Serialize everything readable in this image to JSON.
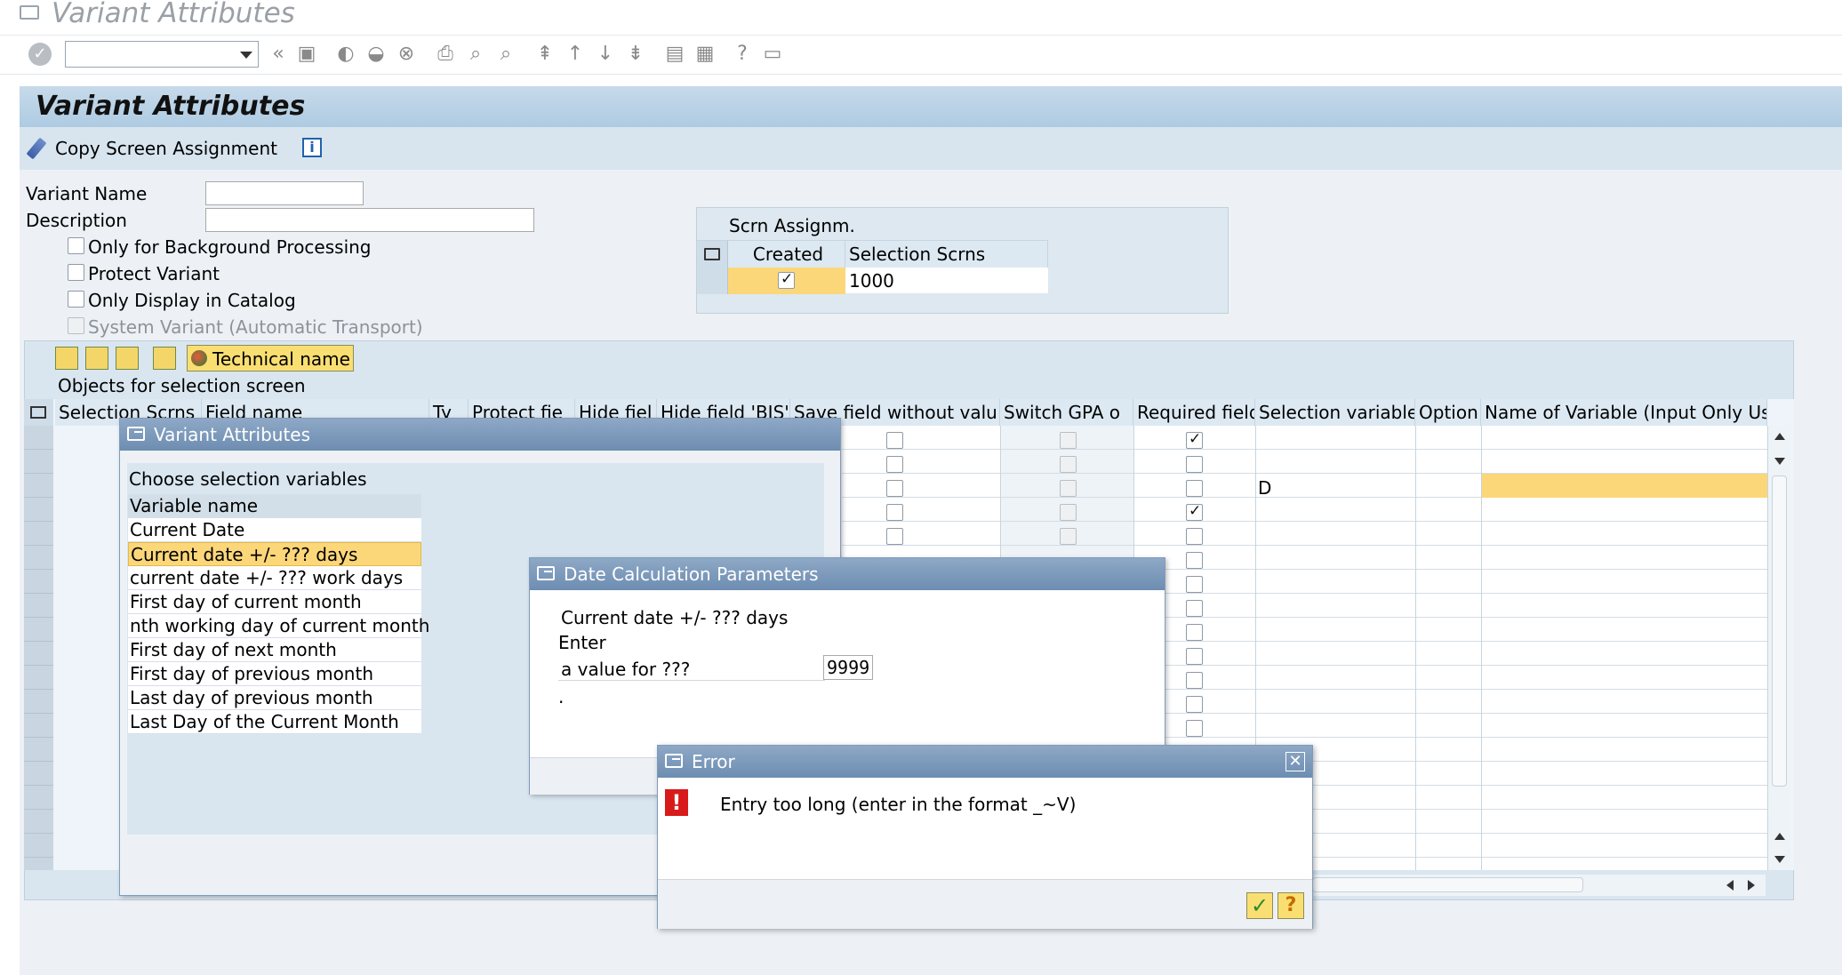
{
  "window_title": "Variant Attributes",
  "page_title": "Variant Attributes",
  "toolbar": {
    "copy_label": "Copy Screen Assignment",
    "command_value": ""
  },
  "form": {
    "variant_name_label": "Variant Name",
    "description_label": "Description",
    "variant_name_value": "",
    "description_value": "",
    "checkboxes": [
      {
        "label": "Only for Background Processing",
        "checked": false
      },
      {
        "label": "Protect Variant",
        "checked": false
      },
      {
        "label": "Only Display in Catalog",
        "checked": false
      },
      {
        "label": "System Variant (Automatic Transport)",
        "checked": false
      }
    ]
  },
  "scrn_assign": {
    "title": "Scrn Assignm.",
    "col_created": "Created",
    "col_screens": "Selection Scrns",
    "row_screen": "1000"
  },
  "objects": {
    "tech_name_label": "Technical name",
    "section_title": "Objects for selection screen",
    "headers": [
      "Selection Scrns",
      "Field name",
      "Ty",
      "Protect fie",
      "Hide fiel",
      "Hide field 'BIS'",
      "Save field without valu",
      "Switch GPA o",
      "Required field",
      "Selection variable",
      "Option",
      "Name of Variable (Input Only Usi"
    ],
    "selection_variable_row3": "D"
  },
  "dialog_variant": {
    "title": "Variant Attributes",
    "subtitle": "Choose selection variables",
    "col_header": "Variable name",
    "items": [
      "Current Date",
      "Current date +/- ??? days",
      "current date +/- ??? work days",
      "First day of current month",
      "nth working day of current month",
      "First day of next month",
      "First day of previous month",
      "Last day of previous month",
      "Last Day of the Current Month"
    ]
  },
  "dialog_date": {
    "title": "Date Calculation Parameters",
    "line1": "Current date +/- ??? days",
    "line2": "Enter",
    "line3_label": "a value for ???",
    "line3_value": "9999",
    "line4": "."
  },
  "dialog_error": {
    "title": "Error",
    "message": "Entry too long (enter in the format _~V)"
  },
  "colors": {
    "header_band": "#b8cfe3",
    "highlight": "#fcd77a",
    "title_bar": "#7c99bb",
    "error_red": "#d81a1a"
  }
}
